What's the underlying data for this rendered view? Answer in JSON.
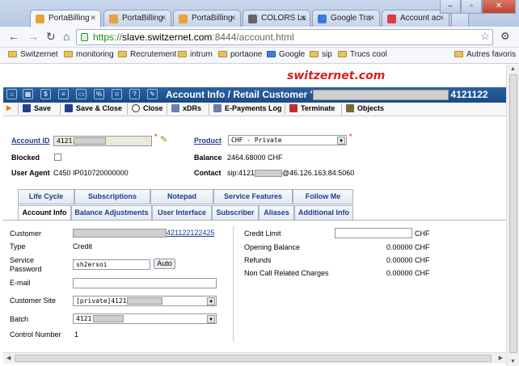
{
  "browser": {
    "tabs": [
      {
        "title": "PortaBilling",
        "color": "#e8a23a",
        "active": true
      },
      {
        "title": "PortaBilling",
        "color": "#e8a23a"
      },
      {
        "title": "PortaBilling",
        "color": "#e8a23a"
      },
      {
        "title": "COLORS Ls",
        "color": "#666666"
      },
      {
        "title": "Google Tra",
        "color": "#3a7be0"
      },
      {
        "title": "Account ac",
        "color": "#d84040"
      }
    ],
    "url_scheme": "https://",
    "url_host": "slave.switzernet.com",
    "url_rest": ":8444/account.html",
    "bookmarks": [
      "Switzernet",
      "monitoring",
      "Recrutement",
      "intrum",
      "portaone",
      "Google",
      "sip",
      "Trucs cool"
    ],
    "other_bookmarks": "Autres favoris"
  },
  "app": {
    "logo": "switzernet.com",
    "title_prefix": "Account Info / Retail Customer '",
    "title_suffix": "4121122",
    "actions": [
      "Save",
      "Save & Close",
      "Close",
      "xDRs",
      "E-Payments Log",
      "Terminate",
      "Objects"
    ],
    "accent": "#1a4a86"
  },
  "account": {
    "account_id_label": "Account ID",
    "account_id_value": "4121",
    "blocked_label": "Blocked",
    "user_agent_label": "User Agent",
    "user_agent_value": "C450 IP010720000000",
    "product_label": "Product",
    "product_value": "CHF - Private",
    "balance_label": "Balance",
    "balance_value": "2464.68000 CHF",
    "contact_label": "Contact",
    "contact_prefix": "sip:4121",
    "contact_suffix": "@46.126.163.84:5060"
  },
  "tabs_top": [
    "Life Cycle",
    "Subscriptions",
    "Notepad",
    "Service Features",
    "Follow Me"
  ],
  "tabs_bottom": [
    "Account Info",
    "Balance Adjustments",
    "User Interface",
    "Subscriber",
    "Aliases",
    "Additional Info"
  ],
  "details": {
    "customer_label": "Customer",
    "customer_link": "421122122425",
    "type_label": "Type",
    "type_value": "Credit",
    "service_password_label": "Service Password",
    "service_password_value": "sh2ersoi",
    "auto_button": "Auto",
    "email_label": "E-mail",
    "customer_site_label": "Customer Site",
    "customer_site_value": "[private]4121",
    "batch_label": "Batch",
    "batch_value": "4121",
    "control_number_label": "Control Number",
    "control_number_value": "1",
    "credit_limit_label": "Credit Limit",
    "credit_limit_currency": "CHF",
    "opening_balance_label": "Opening Balance",
    "opening_balance_value": "0.00000 CHF",
    "refunds_label": "Refunds",
    "refunds_value": "0.00000 CHF",
    "non_call_label": "Non Call Related Charges",
    "non_call_value": "0.00000 CHF"
  }
}
